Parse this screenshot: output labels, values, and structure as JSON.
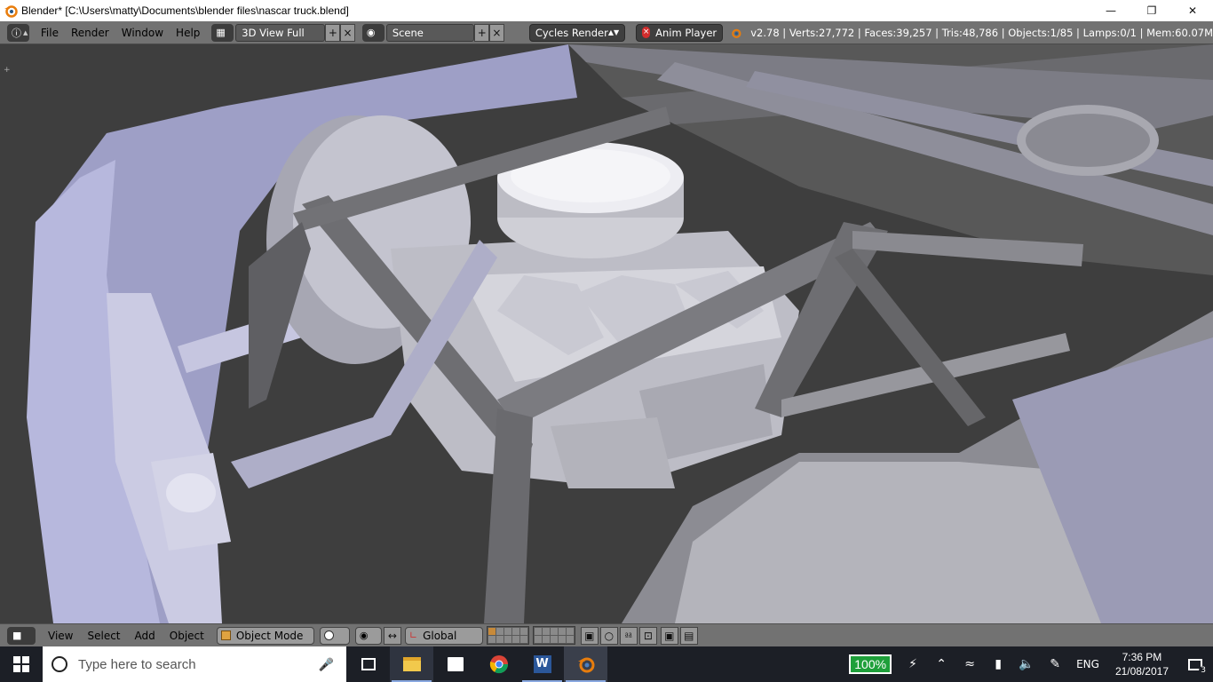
{
  "window": {
    "title": "Blender* [C:\\Users\\matty\\Documents\\blender files\\nascar truck.blend]",
    "controls": [
      "minimize",
      "restore",
      "close"
    ]
  },
  "info_header": {
    "menus": [
      "File",
      "Render",
      "Window",
      "Help"
    ],
    "screen_layout": "3D View Full",
    "scene": "Scene",
    "render_engine": "Cycles Render",
    "anim_player": "Anim Player",
    "stats": "v2.78 | Verts:27,772 | Faces:39,257 | Tris:48,786 | Objects:1/85 | Lamps:0/1 | Mem:60.07M"
  },
  "view3d_header": {
    "menus": [
      "View",
      "Select",
      "Add",
      "Object"
    ],
    "mode": "Object Mode",
    "transform_orientation": "Global"
  },
  "taskbar": {
    "search_placeholder": "Type here to search",
    "apps": [
      "task-view",
      "file-explorer",
      "store",
      "chrome",
      "word",
      "blender"
    ],
    "battery": "100%",
    "language": "ENG",
    "time": "7:36 PM",
    "date": "21/08/2017",
    "notifications": "3"
  },
  "colors": {
    "blender_header": "#727272",
    "viewport_bg": "#3d3d3d",
    "taskbar": "#1c1f26",
    "battery_green": "#1e9f3a"
  }
}
